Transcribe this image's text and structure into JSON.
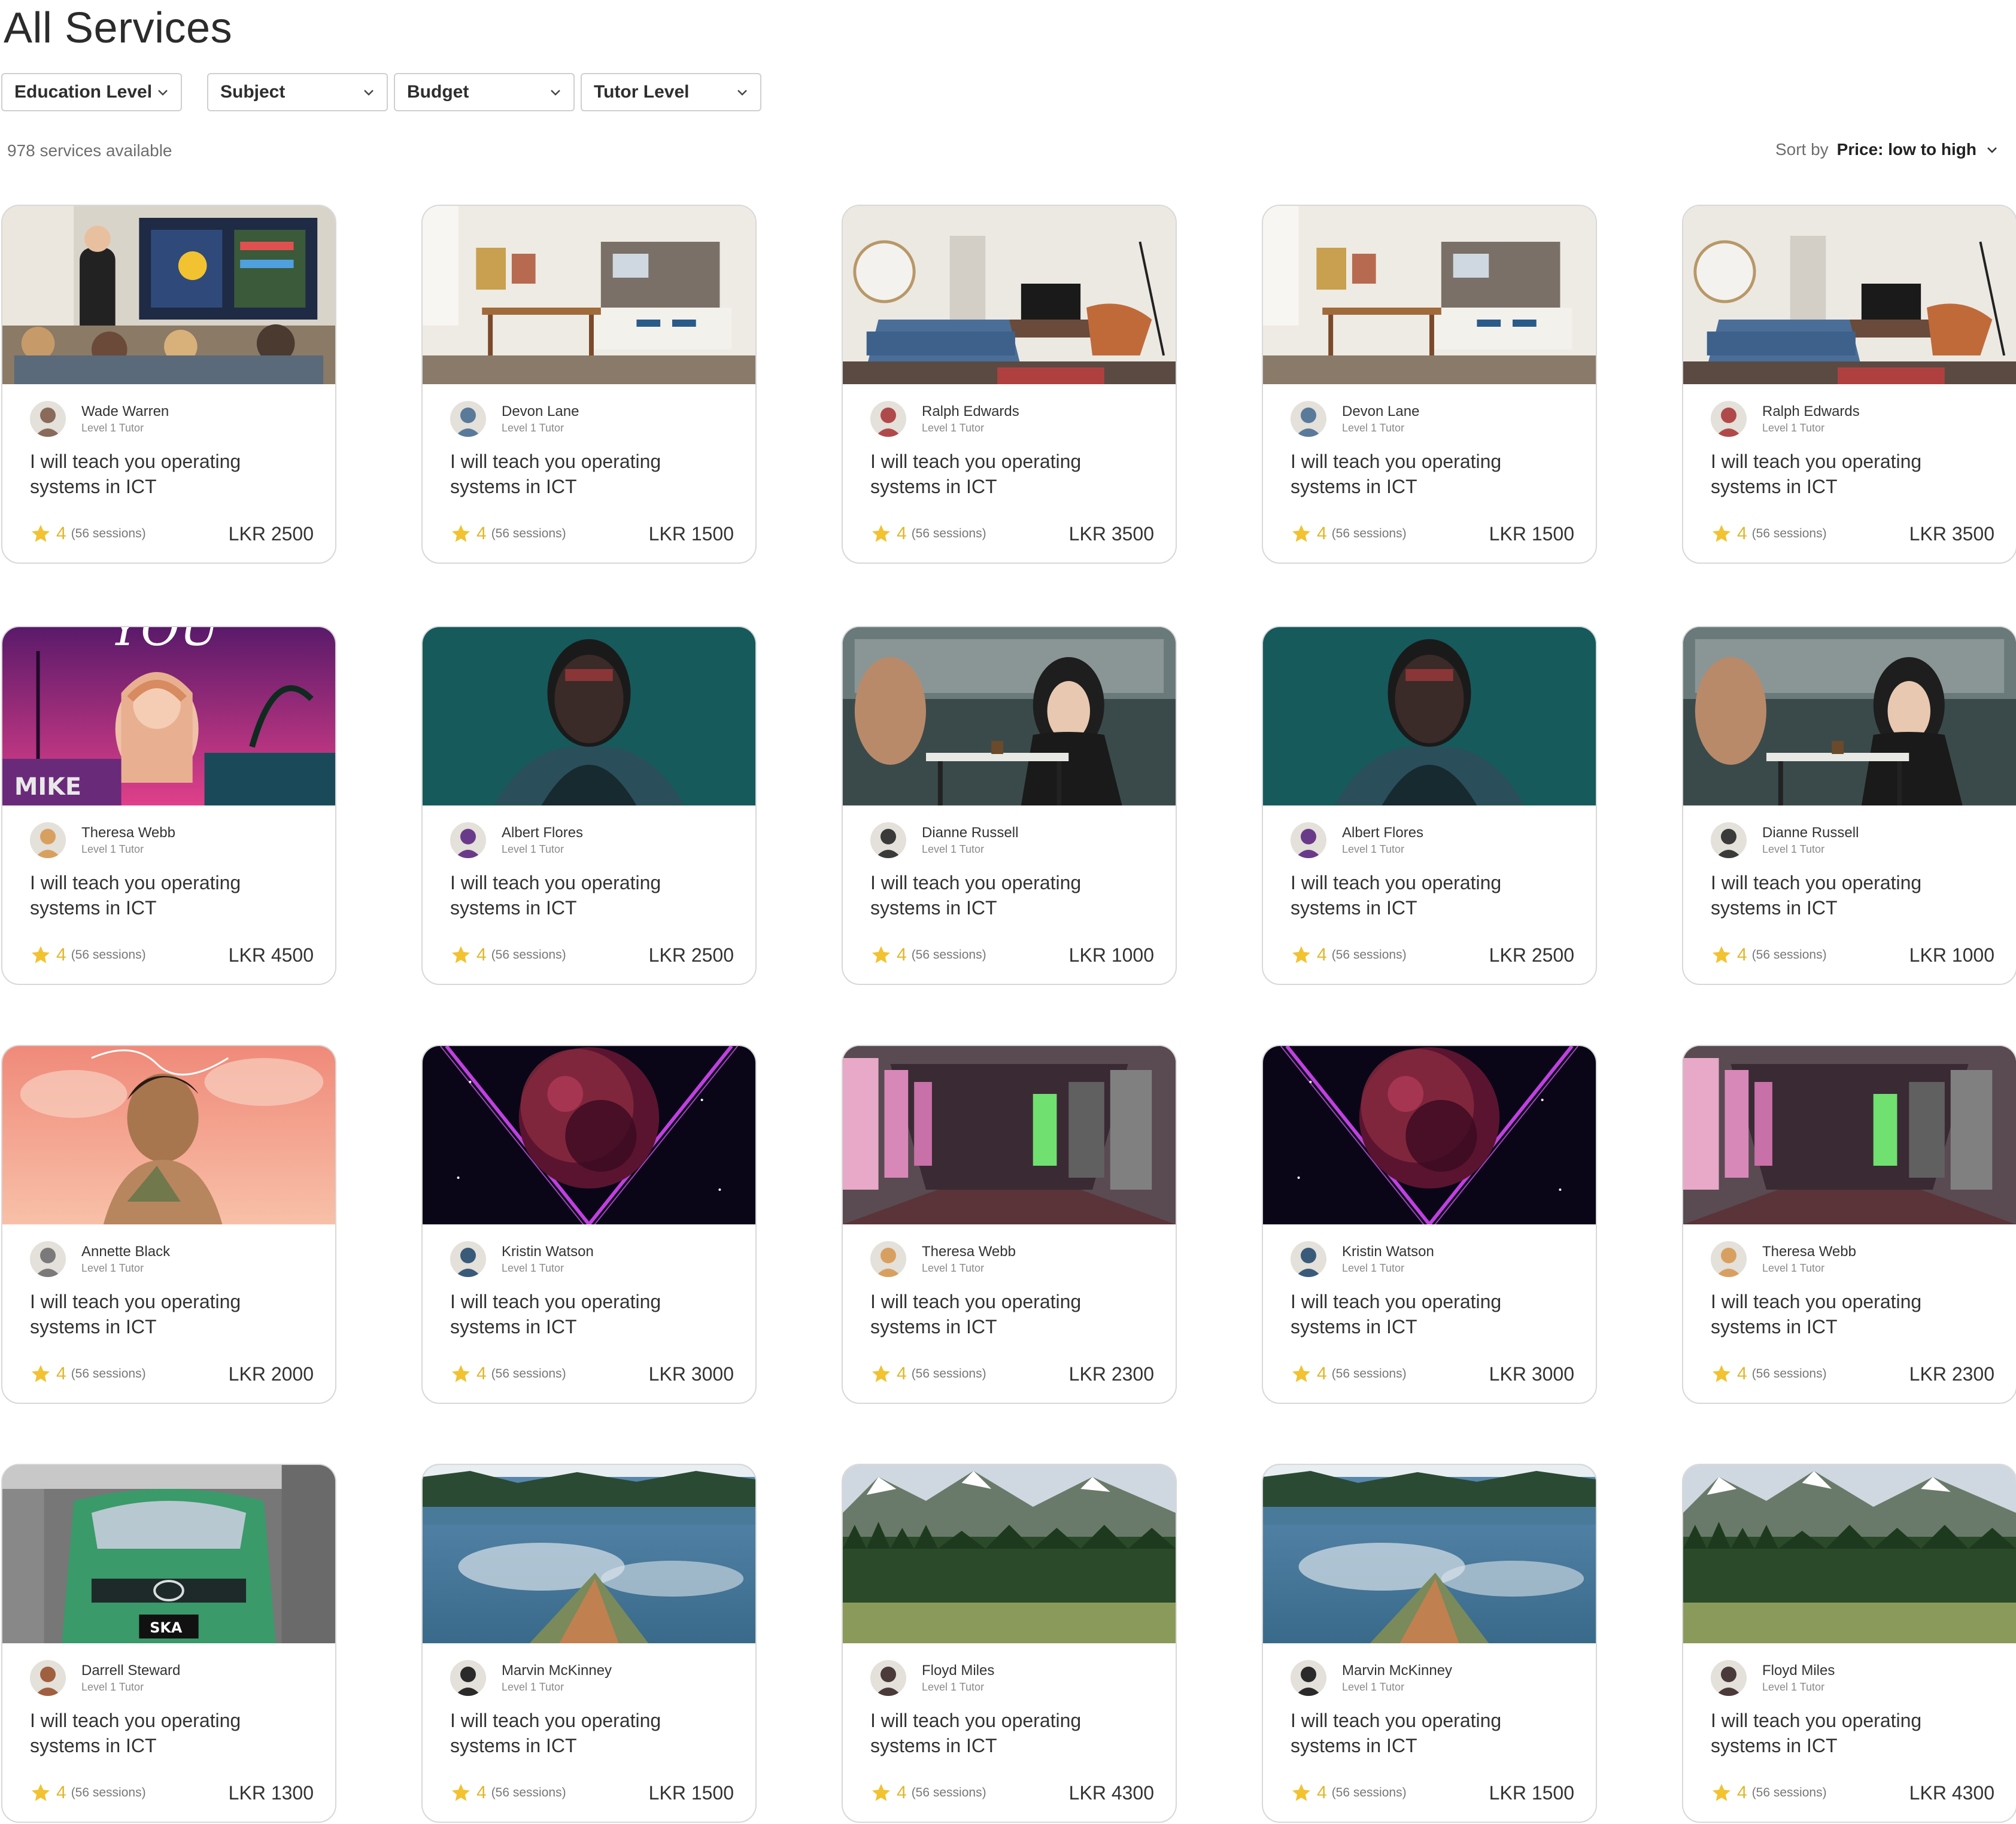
{
  "page_title": "All Services",
  "filters": [
    {
      "label": "Education Level"
    },
    {
      "label": "Subject"
    },
    {
      "label": "Budget"
    },
    {
      "label": "Tutor Level"
    }
  ],
  "results_count": "978 services available",
  "sort": {
    "label": "Sort by",
    "value": "Price: low to high"
  },
  "colors": {
    "star": "#F2C230",
    "rating_text": "#E2B62B",
    "border": "#D8D8D8"
  },
  "cards": [
    {
      "image": "classroom-screen",
      "tutor": "Wade Warren",
      "level": "Level 1 Tutor",
      "title": "I will teach you operating systems in ICT",
      "rating": "4",
      "sessions": "(56 sessions)",
      "price": "LKR 2500"
    },
    {
      "image": "kitchen-dining",
      "tutor": "Devon Lane",
      "level": "Level 1 Tutor",
      "title": "I will teach you operating systems in ICT",
      "rating": "4",
      "sessions": "(56 sessions)",
      "price": "LKR 1500"
    },
    {
      "image": "living-room",
      "tutor": "Ralph Edwards",
      "level": "Level 1 Tutor",
      "title": "I will teach you operating systems in ICT",
      "rating": "4",
      "sessions": "(56 sessions)",
      "price": "LKR 3500"
    },
    {
      "image": "kitchen-dining",
      "tutor": "Devon Lane",
      "level": "Level 1 Tutor",
      "title": "I will teach you operating systems in ICT",
      "rating": "4",
      "sessions": "(56 sessions)",
      "price": "LKR 1500"
    },
    {
      "image": "living-room",
      "tutor": "Ralph Edwards",
      "level": "Level 1 Tutor",
      "title": "I will teach you operating systems in ICT",
      "rating": "4",
      "sessions": "(56 sessions)",
      "price": "LKR 3500"
    },
    {
      "image": "neon-girl",
      "tutor": "Theresa Webb",
      "level": "Level 1 Tutor",
      "title": "I will teach you operating systems in ICT",
      "rating": "4",
      "sessions": "(56 sessions)",
      "price": "LKR 4500"
    },
    {
      "image": "teal-portrait",
      "tutor": "Albert Flores",
      "level": "Level 1 Tutor",
      "title": "I will teach you operating systems in ICT",
      "rating": "4",
      "sessions": "(56 sessions)",
      "price": "LKR 2500"
    },
    {
      "image": "cafe-talk",
      "tutor": "Dianne Russell",
      "level": "Level 1 Tutor",
      "title": "I will teach you operating systems in ICT",
      "rating": "4",
      "sessions": "(56 sessions)",
      "price": "LKR 1000"
    },
    {
      "image": "teal-portrait",
      "tutor": "Albert Flores",
      "level": "Level 1 Tutor",
      "title": "I will teach you operating systems in ICT",
      "rating": "4",
      "sessions": "(56 sessions)",
      "price": "LKR 2500"
    },
    {
      "image": "cafe-talk",
      "tutor": "Dianne Russell",
      "level": "Level 1 Tutor",
      "title": "I will teach you operating systems in ICT",
      "rating": "4",
      "sessions": "(56 sessions)",
      "price": "LKR 1000"
    },
    {
      "image": "pink-portrait",
      "tutor": "Annette Black",
      "level": "Level 1 Tutor",
      "title": "I will teach you operating systems in ICT",
      "rating": "4",
      "sessions": "(56 sessions)",
      "price": "LKR 2000"
    },
    {
      "image": "cosmic-planet",
      "tutor": "Kristin Watson",
      "level": "Level 1 Tutor",
      "title": "I will teach you operating systems in ICT",
      "rating": "4",
      "sessions": "(56 sessions)",
      "price": "LKR 3000"
    },
    {
      "image": "neon-tunnel",
      "tutor": "Theresa Webb",
      "level": "Level 1 Tutor",
      "title": "I will teach you operating systems in ICT",
      "rating": "4",
      "sessions": "(56 sessions)",
      "price": "LKR 2300"
    },
    {
      "image": "cosmic-planet",
      "tutor": "Kristin Watson",
      "level": "Level 1 Tutor",
      "title": "I will teach you operating systems in ICT",
      "rating": "4",
      "sessions": "(56 sessions)",
      "price": "LKR 3000"
    },
    {
      "image": "neon-tunnel",
      "tutor": "Theresa Webb",
      "level": "Level 1 Tutor",
      "title": "I will teach you operating systems in ICT",
      "rating": "4",
      "sessions": "(56 sessions)",
      "price": "LKR 2300"
    },
    {
      "image": "green-car",
      "tutor": "Darrell Steward",
      "level": "Level 1 Tutor",
      "title": "I will teach you operating systems in ICT",
      "rating": "4",
      "sessions": "(56 sessions)",
      "price": "LKR 1300"
    },
    {
      "image": "lake-canoe",
      "tutor": "Marvin McKinney",
      "level": "Level 1 Tutor",
      "title": "I will teach you operating systems in ICT",
      "rating": "4",
      "sessions": "(56 sessions)",
      "price": "LKR 1500"
    },
    {
      "image": "mountain-meadow",
      "tutor": "Floyd Miles",
      "level": "Level 1 Tutor",
      "title": "I will teach you operating systems in ICT",
      "rating": "4",
      "sessions": "(56 sessions)",
      "price": "LKR 4300"
    },
    {
      "image": "lake-canoe",
      "tutor": "Marvin McKinney",
      "level": "Level 1 Tutor",
      "title": "I will teach you operating systems in ICT",
      "rating": "4",
      "sessions": "(56 sessions)",
      "price": "LKR 1500"
    },
    {
      "image": "mountain-meadow",
      "tutor": "Floyd Miles",
      "level": "Level 1 Tutor",
      "title": "I will teach you operating systems in ICT",
      "rating": "4",
      "sessions": "(56 sessions)",
      "price": "LKR 4300"
    }
  ]
}
